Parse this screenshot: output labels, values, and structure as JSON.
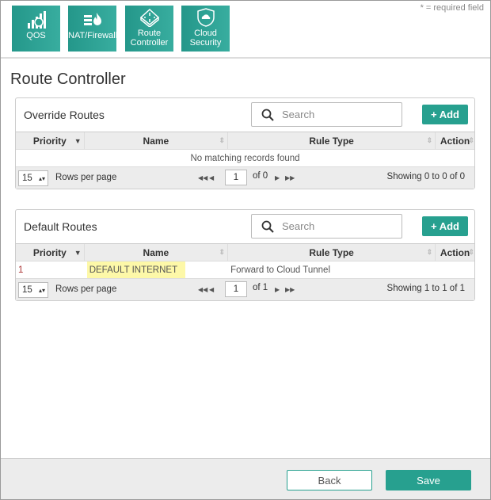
{
  "required_note": "* = required field",
  "tiles": [
    {
      "label": "QOS",
      "icon": "signal-bars-icon"
    },
    {
      "label": "NAT/Firewall",
      "icon": "firewall-icon"
    },
    {
      "label": "Route Controller",
      "icon": "router-icon"
    },
    {
      "label": "Cloud Security",
      "icon": "cloud-shield-icon"
    }
  ],
  "page_title": "Route Controller",
  "columns": [
    "Priority",
    "Name",
    "Rule Type",
    "Action"
  ],
  "override": {
    "title": "Override Routes",
    "search_placeholder": "Search",
    "add": "+ Add",
    "empty": "No matching records found",
    "rows_per_page": "15",
    "rows_label": "Rows per page",
    "page": "1",
    "of": "of 0",
    "showing": "Showing 0 to 0 of 0"
  },
  "default": {
    "title": "Default Routes",
    "search_placeholder": "Search",
    "add": "+ Add",
    "rows": [
      {
        "priority": "1",
        "name": "DEFAULT INTERNET",
        "rule_type": "Forward to Cloud Tunnel"
      }
    ],
    "rows_per_page": "15",
    "rows_label": "Rows per page",
    "page": "1",
    "of": "of 1",
    "showing": "Showing 1 to 1 of 1"
  },
  "buttons": {
    "back": "Back",
    "save": "Save"
  },
  "colors": {
    "accent": "#27a08f",
    "highlight": "#fdf8a8"
  }
}
